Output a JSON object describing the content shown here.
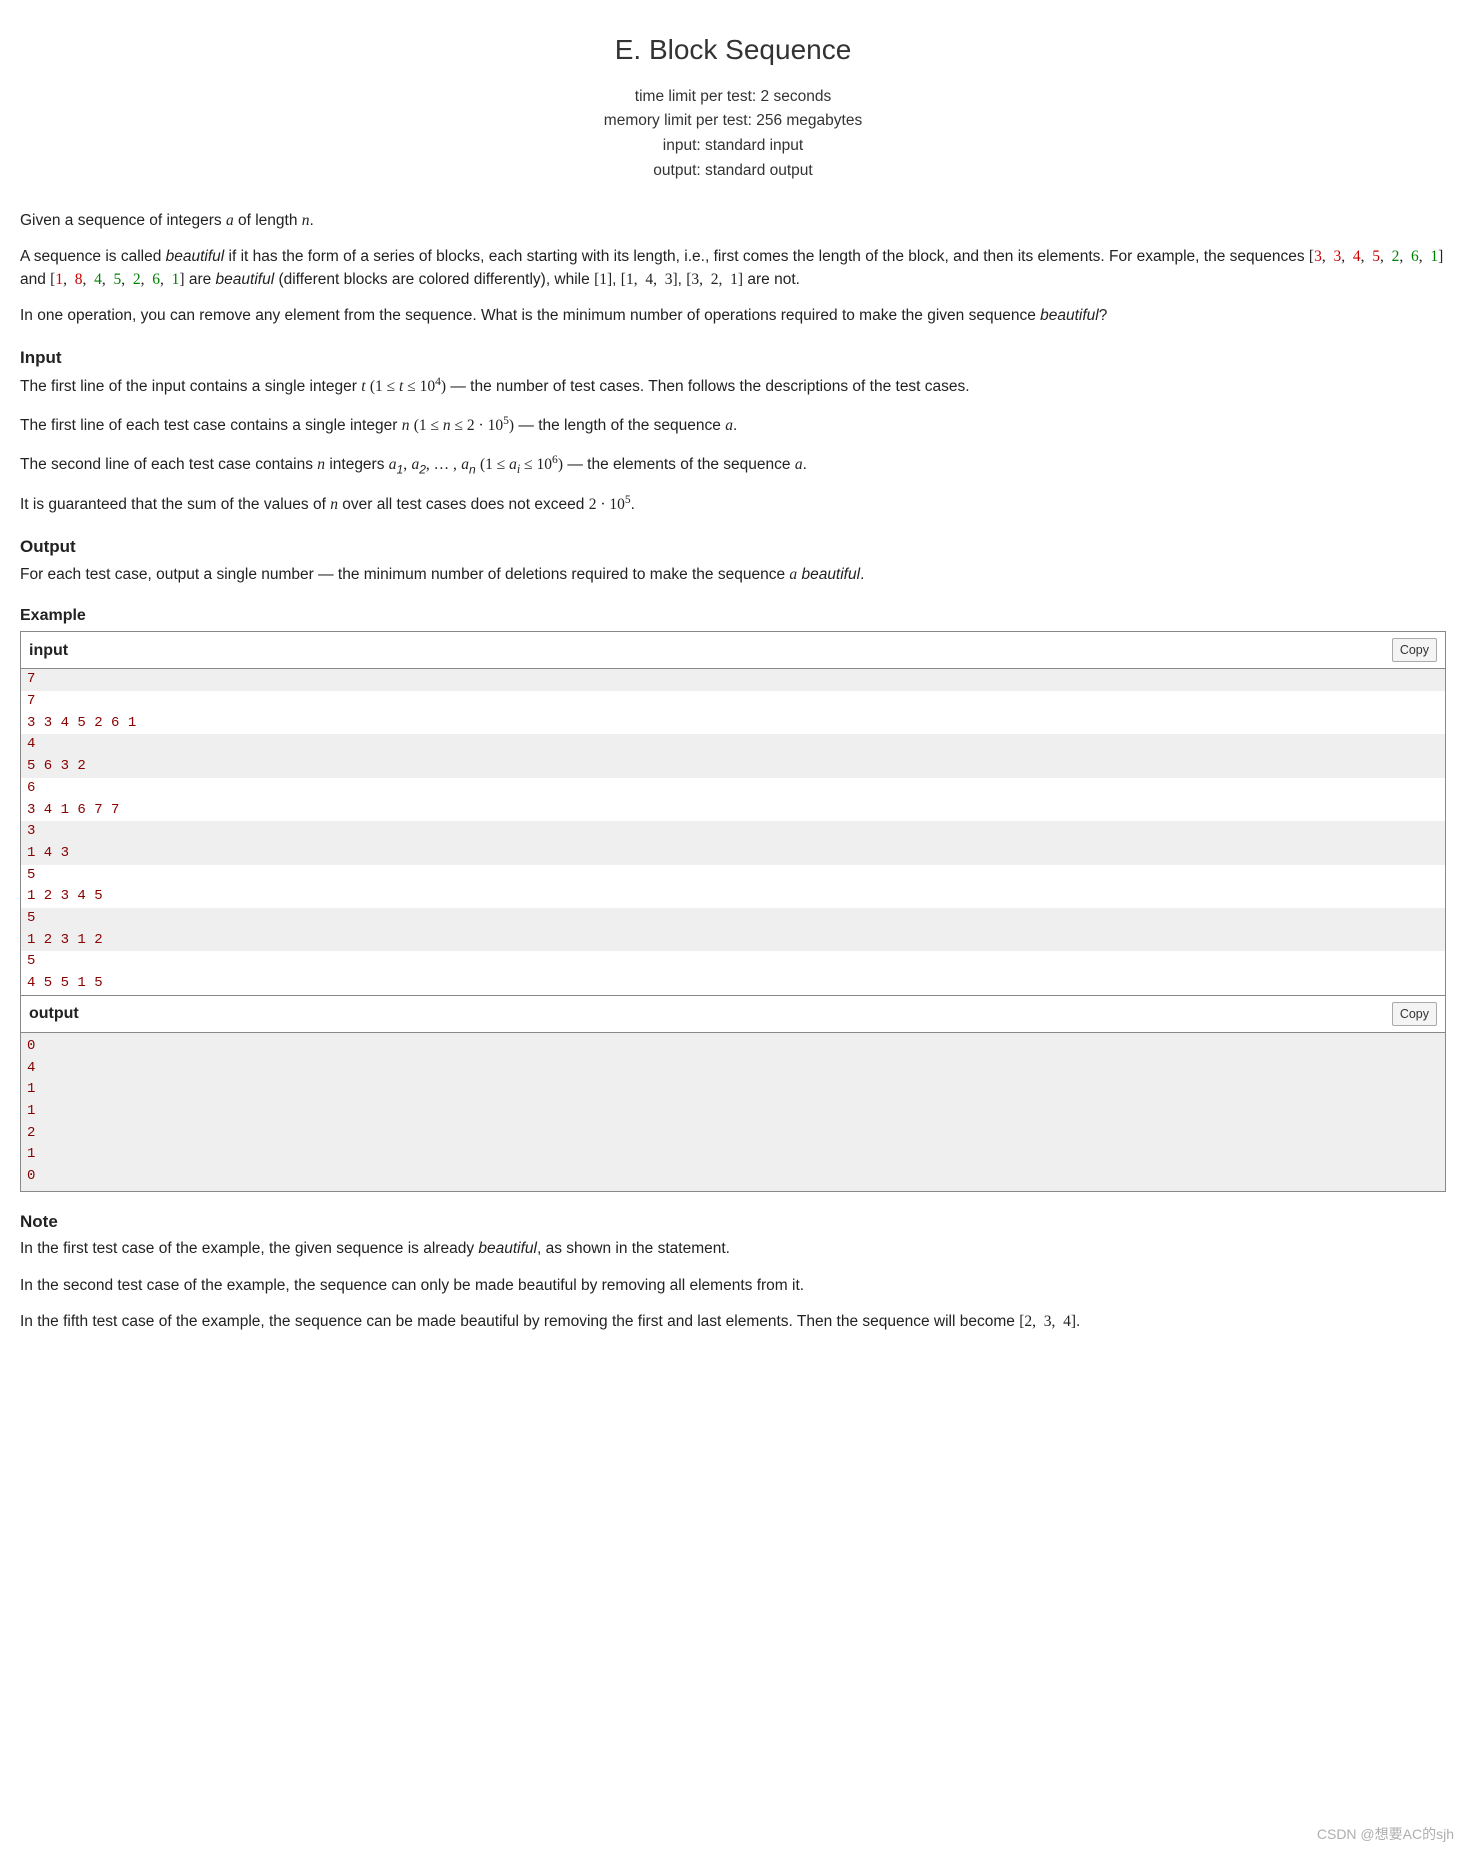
{
  "title": "E. Block Sequence",
  "limits": {
    "time": "time limit per test: 2 seconds",
    "memory": "memory limit per test: 256 megabytes",
    "input": "input: standard input",
    "output": "output: standard output"
  },
  "section": {
    "input_title": "Input",
    "output_title": "Output",
    "example_title": "Example",
    "note_title": "Note"
  },
  "io": {
    "input_label": "input",
    "output_label": "output",
    "copy_label": "Copy"
  },
  "sample_input_groups": [
    [
      "7"
    ],
    [
      "7",
      "3 3 4 5 2 6 1"
    ],
    [
      "4",
      "5 6 3 2"
    ],
    [
      "6",
      "3 4 1 6 7 7"
    ],
    [
      "3",
      "1 4 3"
    ],
    [
      "5",
      "1 2 3 4 5"
    ],
    [
      "5",
      "1 2 3 1 2"
    ],
    [
      "5",
      "4 5 5 1 5"
    ]
  ],
  "sample_output": "0\n4\n1\n1\n2\n1\n0",
  "watermark": "CSDN @想要AC的sjh"
}
